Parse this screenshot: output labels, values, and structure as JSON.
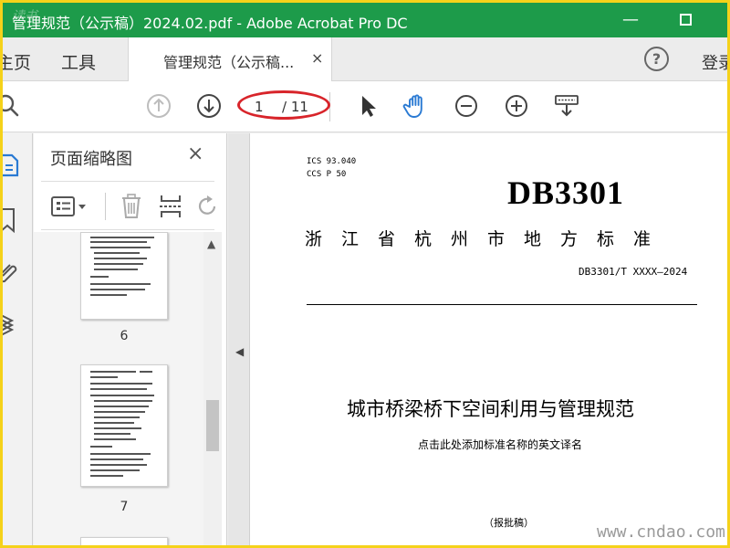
{
  "window": {
    "title": "管理规范（公示稿）2024.02.pdf - Adobe Acrobat Pro DC",
    "watermark_top": "读书",
    "minimize_glyph": "—"
  },
  "tabs": {
    "home": "主页",
    "tools": "工具",
    "document_tab": "管理规范（公示稿...",
    "close_glyph": "×",
    "help_glyph": "?",
    "signin": "登录"
  },
  "toolbar": {
    "current_page": "1",
    "total_pages": "/ 11"
  },
  "thumbnail_panel": {
    "title": "页面缩略图",
    "close_glyph": "×",
    "scroll_up_glyph": "▲",
    "pages": [
      {
        "number": "6"
      },
      {
        "number": "7"
      }
    ]
  },
  "document": {
    "collapse_glyph": "◀",
    "ics": "ICS  93.040",
    "ccs": "CCS  P 50",
    "db_code": "DB3301",
    "standard_type": "浙江省杭州市地方标准",
    "standard_number": "DB3301/T XXXX—2024",
    "main_title": "城市桥梁桥下空间利用与管理规范",
    "english_title_placeholder": "点击此处添加标准名称的英文译名",
    "draft_note": "（报批稿）"
  },
  "site_watermark": "www.cndao.com",
  "colors": {
    "titlebar": "#1d9b4a",
    "border": "#f5d21a",
    "accent_blue": "#2a7ad3",
    "annotation_red": "#d8242a"
  }
}
